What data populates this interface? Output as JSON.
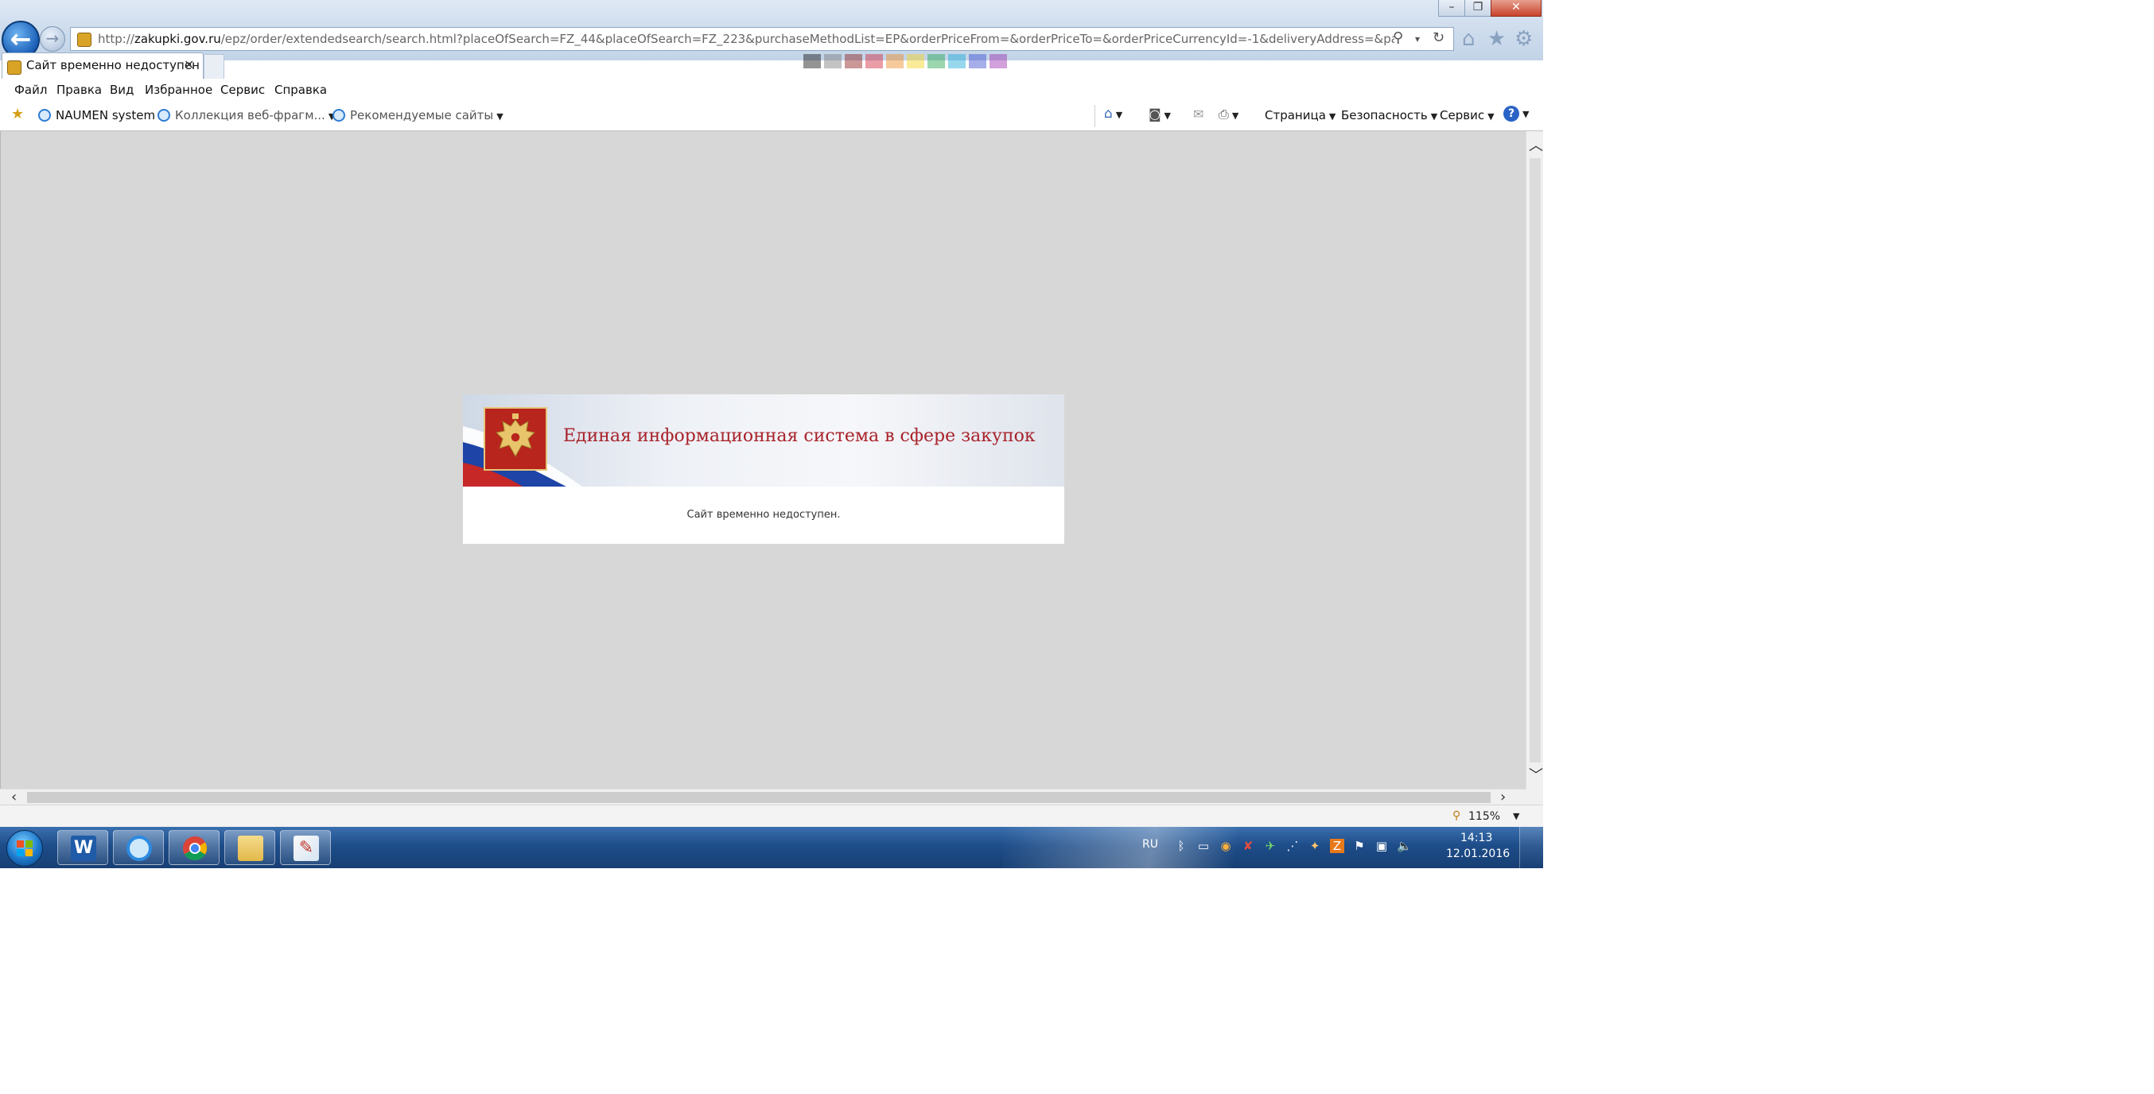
{
  "browser": {
    "url_host": "zakupki.gov.ru",
    "url_prefix": "http://",
    "url_path": "/epz/order/extendedsearch/search.html?placeOfSearch=FZ_44&placeOfSearch=FZ_223&purchaseMethodList=EP&orderPriceFrom=&orderPriceTo=&orderPriceCurrencyId=-1&deliveryAddress=&participantName=&orderP",
    "tab_title": "Сайт временно недоступен",
    "menu": [
      "Файл",
      "Правка",
      "Вид",
      "Избранное",
      "Сервис",
      "Справка"
    ],
    "favorites": [
      "NAUMEN system",
      "Коллекция веб-фрагм...",
      "Рекомендуемые сайты"
    ],
    "command_bar": [
      "Страница",
      "Безопасность",
      "Сервис"
    ],
    "zoom": "115%"
  },
  "page": {
    "banner_title": "Единая информационная система в сфере закупок",
    "message": "Сайт временно недоступен."
  },
  "taskbar": {
    "language": "RU",
    "time": "14:13",
    "date": "12.01.2016"
  },
  "colors": {
    "banner_title": "#a8222a",
    "viewport_bg": "#d7d7d7",
    "taskbar": "#1e4d89"
  }
}
